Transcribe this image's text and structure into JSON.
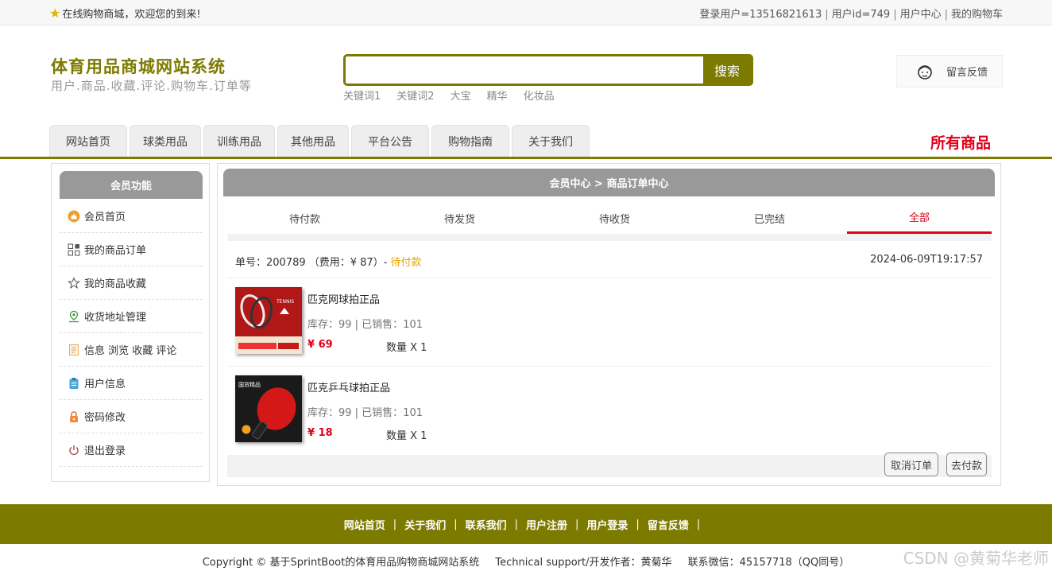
{
  "topbar": {
    "welcome": "在线购物商城，欢迎您的到来!",
    "user_label": "登录用户=13516821613",
    "userid_label": "用户id=749",
    "user_center": "用户中心",
    "cart": "我的购物车"
  },
  "header": {
    "title": "体育用品商城网站系统",
    "subtitle": "用户.商品.收藏.评论.购物车.订单等",
    "search_button": "搜索",
    "search_value": "",
    "hotwords": [
      "关键词1",
      "关键词2",
      "大宝",
      "精华",
      "化妆品"
    ],
    "feedback": "留言反馈"
  },
  "nav": {
    "tabs": [
      "网站首页",
      "球类用品",
      "训练用品",
      "其他用品",
      "平台公告",
      "购物指南",
      "关于我们"
    ],
    "all_goods": "所有商品"
  },
  "sidebar": {
    "title": "会员功能",
    "items": [
      "会员首页",
      "我的商品订单",
      "我的商品收藏",
      "收货地址管理",
      "信息 浏览 收藏 评论",
      "用户信息",
      "密码修改",
      "退出登录"
    ]
  },
  "main": {
    "breadcrumb": "会员中心 > 商品订单中心",
    "tabs": [
      "待付款",
      "待发货",
      "待收货",
      "已完结",
      "全部"
    ],
    "active_tab": "全部",
    "order": {
      "number_text": "单号：200789 （费用：¥ 87）-",
      "status": "待付款",
      "time": "2024-06-09T19:17:57",
      "items": [
        {
          "name": "匹克网球拍正品",
          "stock": "库存：99 | 已销售：101",
          "price": "¥ 69",
          "qty": "数量 X 1"
        },
        {
          "name": "匹克乒乓球拍正品",
          "stock": "库存：99 | 已销售：101",
          "price": "¥ 18",
          "qty": "数量 X 1"
        }
      ],
      "cancel_button": "取消订单",
      "pay_button": "去付款"
    }
  },
  "footer": {
    "links": [
      "网站首页",
      "关于我们",
      "联系我们",
      "用户注册",
      "用户登录",
      "留言反馈"
    ],
    "copyright": "Copyright © 基于SprintBoot的体育用品购物商城网站系统",
    "support": "Technical support/开发作者：黄菊华",
    "contact": "联系微信：45157718（QQ同号）"
  },
  "watermark": "CSDN @黄菊华老师",
  "colors": {
    "brand": "#7d7a00",
    "accent_red": "#e0001a",
    "status_orange": "#e8a000",
    "panel_head": "#999999"
  }
}
